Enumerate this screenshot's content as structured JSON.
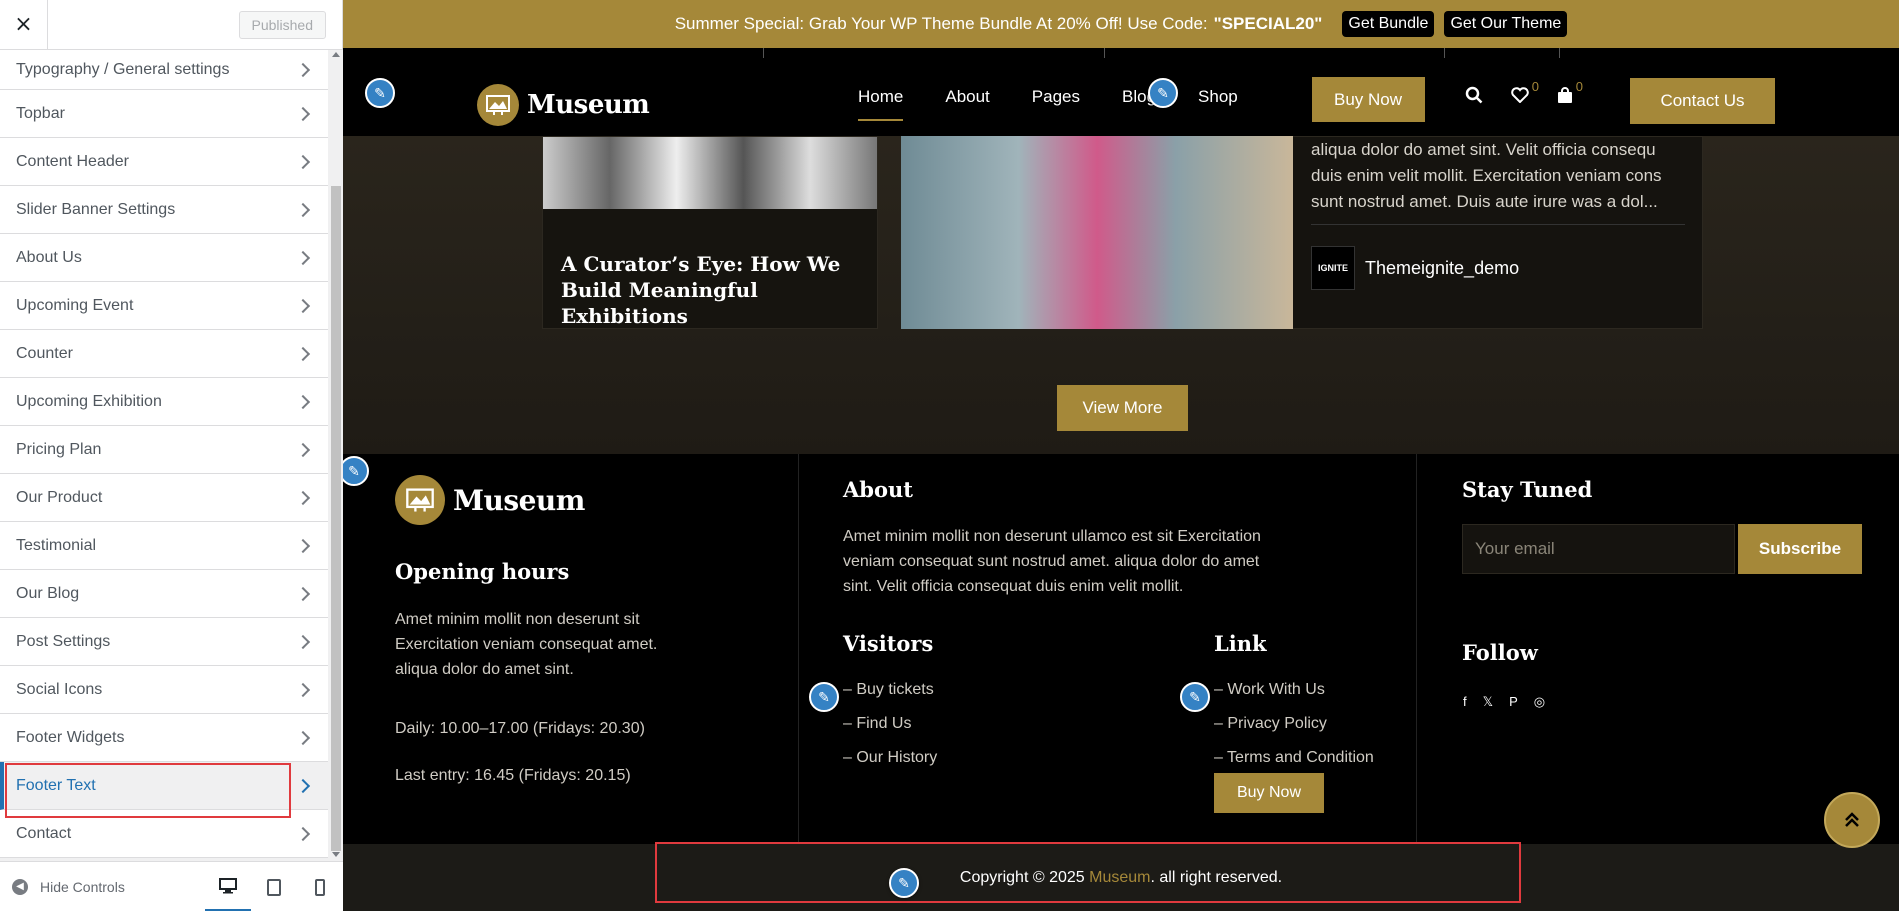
{
  "sidebar": {
    "close_icon": "×",
    "published_label": "Published",
    "items": [
      {
        "label": "Typography / General settings"
      },
      {
        "label": "Topbar"
      },
      {
        "label": "Content Header"
      },
      {
        "label": "Slider Banner Settings"
      },
      {
        "label": "About Us"
      },
      {
        "label": "Upcoming Event"
      },
      {
        "label": "Counter"
      },
      {
        "label": "Upcoming Exhibition"
      },
      {
        "label": "Pricing Plan"
      },
      {
        "label": "Our Product"
      },
      {
        "label": "Testimonial"
      },
      {
        "label": "Our Blog"
      },
      {
        "label": "Post Settings"
      },
      {
        "label": "Social Icons"
      },
      {
        "label": "Footer Widgets"
      },
      {
        "label": "Footer Text"
      },
      {
        "label": "Contact"
      }
    ],
    "hide_controls_label": "Hide Controls"
  },
  "topbar": {
    "promo_text": "Summer Special: Grab Your WP Theme Bundle At 20% Off! Use Code:",
    "promo_code": "\"SPECIAL20\"",
    "get_bundle_label": "Get Bundle",
    "get_theme_label": "Get Our Theme"
  },
  "header": {
    "logo_text": "Museum",
    "nav": [
      "Home",
      "About",
      "Pages",
      "Blog",
      "Shop"
    ],
    "buy_now_label": "Buy Now",
    "wishlist_count": "0",
    "cart_count": "0",
    "contact_label": "Contact Us"
  },
  "blog": {
    "card1_title": "A Curator’s Eye: How We Build Meaningful Exhibitions",
    "card3_text": "aliqua dolor do amet sint. Velit officia consequ duis enim velit mollit. Exercitation veniam cons sunt nostrud amet. Duis aute irure was a dol...",
    "author_logo": "IGNITE",
    "author_name": "Themeignite_demo",
    "view_more_label": "View More"
  },
  "footer": {
    "logo_text": "Museum",
    "opening_title": "Opening hours",
    "opening_text": "Amet minim mollit non deserunt sit Exercitation veniam consequat amet. aliqua dolor do amet sint.",
    "daily": "Daily: 10.00–17.00 (Fridays: 20.30)",
    "last_entry": "Last entry: 16.45 (Fridays: 20.15)",
    "about_title": "About",
    "about_text": "Amet minim mollit non deserunt ullamco est sit Exercitation veniam consequat sunt nostrud amet. aliqua dolor do amet sint. Velit officia consequat duis enim velit mollit.",
    "visitors_title": "Visitors",
    "visitors_links": [
      "– Buy tickets",
      "– Find Us",
      "– Our History"
    ],
    "link_title": "Link",
    "link_links": [
      "– Work With Us",
      "– Privacy Policy",
      "– Terms and Condition"
    ],
    "buy_now_label": "Buy Now",
    "stay_tuned_title": "Stay Tuned",
    "email_placeholder": "Your email",
    "subscribe_label": "Subscribe",
    "follow_title": "Follow",
    "copyright_prefix": "Copyright © 2025 ",
    "copyright_link": "Museum",
    "copyright_suffix": ". all right reserved."
  },
  "colors": {
    "accent": "#a58839",
    "customizer_blue": "#2271b1",
    "highlight_red": "#e03a3e"
  }
}
